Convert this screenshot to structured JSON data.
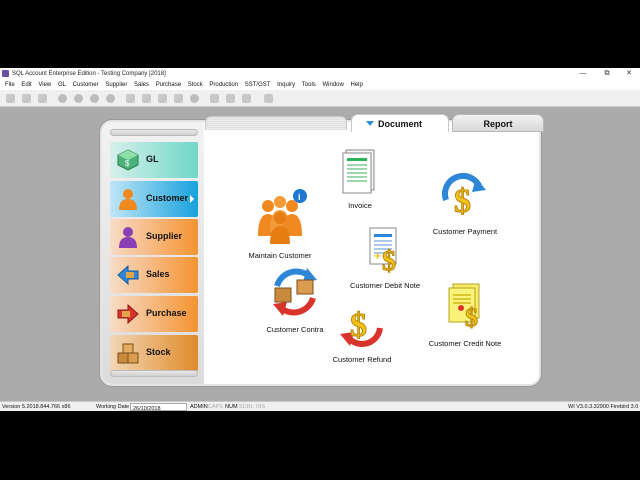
{
  "window": {
    "title": "SQL Account Enterprise Edition - Testing Company [2018]",
    "min_glyph": "—",
    "max_glyph": "⧉",
    "close_glyph": "✕"
  },
  "menu": [
    "File",
    "Edit",
    "View",
    "GL",
    "Customer",
    "Supplier",
    "Sales",
    "Purchase",
    "Stock",
    "Production",
    "SST/GST",
    "Inquiry",
    "Tools",
    "Window",
    "Help"
  ],
  "nav": {
    "gl": "GL",
    "customer": "Customer",
    "supplier": "Supplier",
    "sales": "Sales",
    "purchase": "Purchase",
    "stock": "Stock"
  },
  "tabs": {
    "document": "Document",
    "report": "Report"
  },
  "items": {
    "invoice": "Invoice",
    "maintain_customer": "Maintain Customer",
    "customer_payment": "Customer Payment",
    "customer_debit_note": "Customer Debit Note",
    "customer_contra": "Customer Contra",
    "customer_refund": "Customer Refund",
    "customer_credit_note": "Customer Credit Note"
  },
  "status": {
    "version": "Version 5.2018.844.766 x86",
    "working_date_label": "Working Date",
    "working_date": "26/10/2018",
    "user": "ADMIN",
    "caps": "CAPS",
    "num": "NUM",
    "scrl": "SCRL",
    "ins": "INS",
    "build": "WI V3.0.3.32900 Firebird 3.0"
  },
  "colors": {
    "gl": "#6fd7c8",
    "customer": "#17a2dc",
    "orange": "#f59331",
    "brand": "#6b4fa3"
  }
}
